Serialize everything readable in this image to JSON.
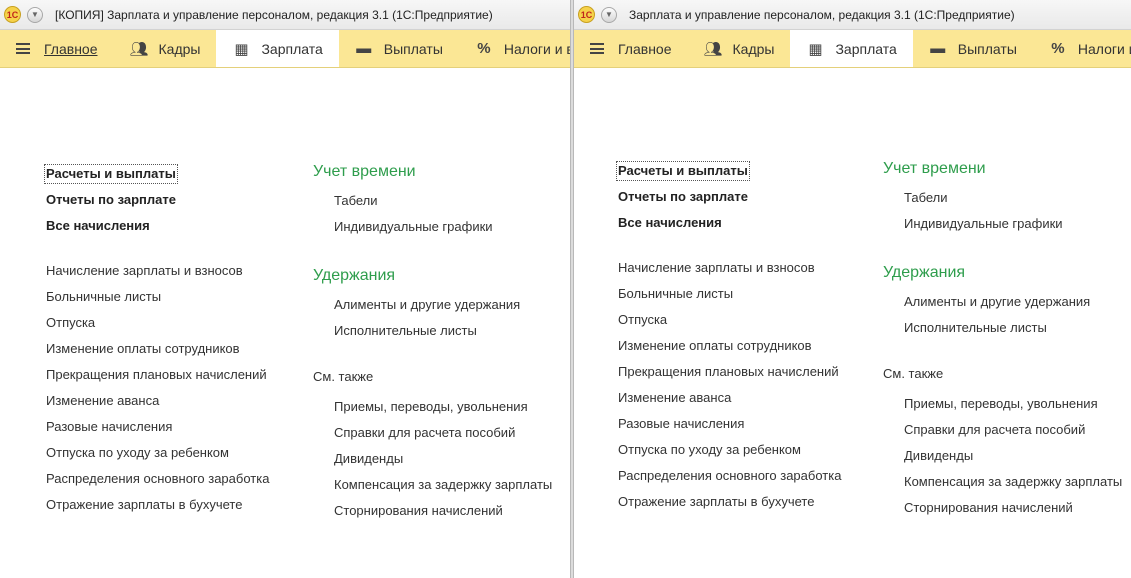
{
  "windows": [
    {
      "title": "[КОПИЯ] Зарплата и управление персоналом, редакция 3.1  (1С:Предприятие)",
      "logo": "1С",
      "tabs": [
        {
          "label": "Главное",
          "icon": "hamburger-icon",
          "active": false,
          "underlined": true
        },
        {
          "label": "Кадры",
          "icon": "people-icon",
          "active": false
        },
        {
          "label": "Зарплата",
          "icon": "calculator-icon",
          "active": true
        },
        {
          "label": "Выплаты",
          "icon": "wallet-icon",
          "active": false
        },
        {
          "label": "Налоги и взносы",
          "icon": "percent-icon",
          "active": false
        }
      ],
      "left_bold": [
        "Расчеты и выплаты",
        "Отчеты по зарплате",
        "Все начисления"
      ],
      "left_list": [
        "Начисление зарплаты и взносов",
        "Больничные листы",
        "Отпуска",
        "Изменение оплаты сотрудников",
        "Прекращения плановых начислений",
        "Изменение аванса",
        "Разовые начисления",
        "Отпуска по уходу за ребенком",
        "Распределения основного заработка",
        "Отражение зарплаты в бухучете"
      ],
      "groups": [
        {
          "title": "Учет времени",
          "items": [
            "Табели",
            "Индивидуальные графики"
          ]
        },
        {
          "title": "Удержания",
          "items": [
            "Алименты и другие удержания",
            "Исполнительные листы"
          ]
        }
      ],
      "see_also": {
        "title": "См. также",
        "items": [
          "Приемы, переводы, увольнения",
          "Справки для расчета пособий",
          "Дивиденды",
          "Компенсация за задержку зарплаты",
          "Сторнирования начислений"
        ]
      }
    },
    {
      "title": "Зарплата и управление персоналом, редакция 3.1  (1С:Предприятие)",
      "logo": "1С",
      "tabs": [
        {
          "label": "Главное",
          "icon": "hamburger-icon",
          "active": false
        },
        {
          "label": "Кадры",
          "icon": "people-icon",
          "active": false
        },
        {
          "label": "Зарплата",
          "icon": "calculator-icon",
          "active": true
        },
        {
          "label": "Выплаты",
          "icon": "wallet-icon",
          "active": false
        },
        {
          "label": "Налоги и взносы",
          "icon": "percent-icon",
          "active": false
        }
      ],
      "left_bold": [
        "Расчеты и выплаты",
        "Отчеты по зарплате",
        "Все начисления"
      ],
      "left_list": [
        "Начисление зарплаты и взносов",
        "Больничные листы",
        "Отпуска",
        "Изменение оплаты сотрудников",
        "Прекращения плановых начислений",
        "Изменение аванса",
        "Разовые начисления",
        "Отпуска по уходу за ребенком",
        "Распределения основного заработка",
        "Отражение зарплаты в бухучете"
      ],
      "groups": [
        {
          "title": "Учет времени",
          "items": [
            "Табели",
            "Индивидуальные графики"
          ]
        },
        {
          "title": "Удержания",
          "items": [
            "Алименты и другие удержания",
            "Исполнительные листы"
          ]
        }
      ],
      "see_also": {
        "title": "См. также",
        "items": [
          "Приемы, переводы, увольнения",
          "Справки для расчета пособий",
          "Дивиденды",
          "Компенсация за задержку зарплаты",
          "Сторнирования начислений"
        ]
      }
    }
  ],
  "colors": {
    "tabbar": "#fbe795",
    "group_heading": "#2e9d4c",
    "text": "#333333"
  }
}
